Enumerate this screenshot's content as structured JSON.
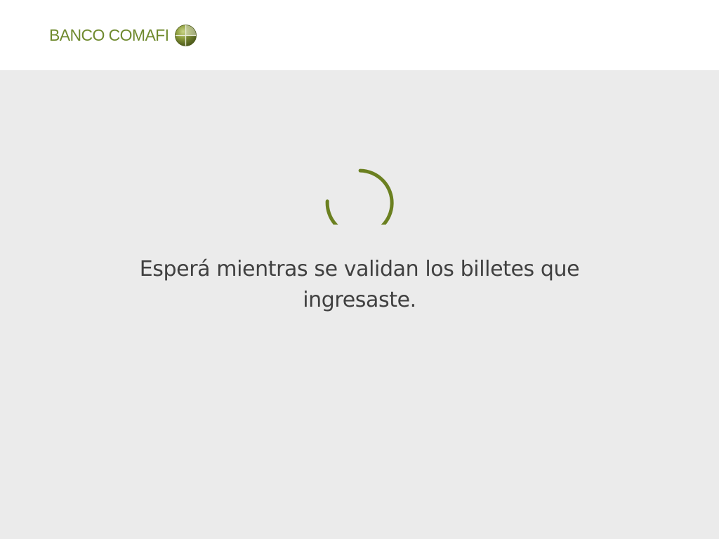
{
  "header": {
    "brand_name": "BANCO COMAFI",
    "logo_icon": "comafi-globe-icon"
  },
  "main": {
    "spinner_icon": "loading-spinner-icon",
    "message": "Esperá mientras se validan los billetes que ingresaste."
  },
  "colors": {
    "brand_green": "#6f8a2e",
    "spinner_green": "#6b8020",
    "background": "#ebebeb",
    "header_background": "#ffffff",
    "text": "#404040"
  }
}
